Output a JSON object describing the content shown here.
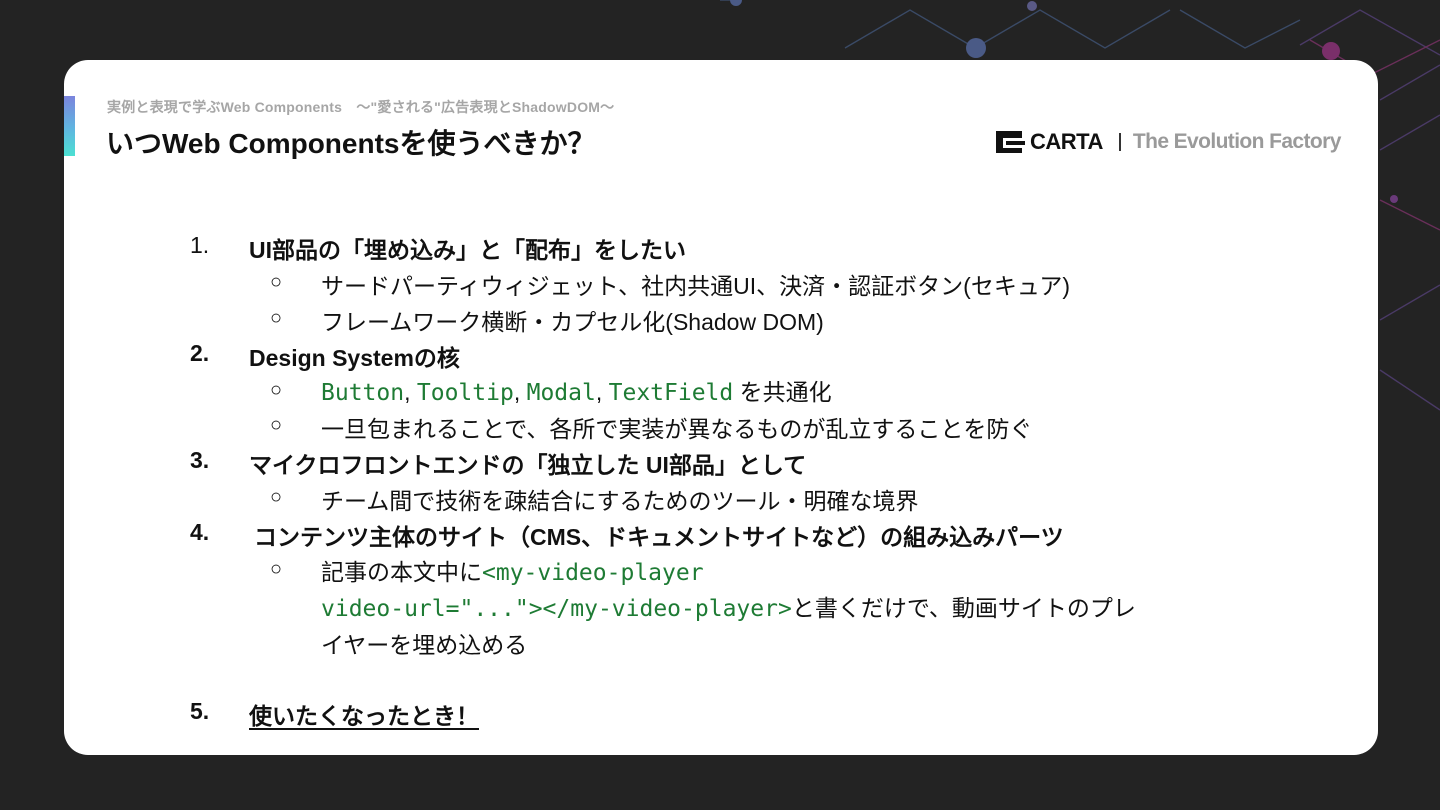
{
  "header": {
    "subtitle": "実例と表現で学ぶWeb Components　～\"愛される\"広告表現とShadowDOM～",
    "title": "いつWeb Componentsを使うべきか？"
  },
  "logo": {
    "brand": "CARTA",
    "tagline": "The Evolution Factory"
  },
  "items": [
    {
      "number": "1.",
      "heading": "UI部品の「埋め込み」と「配布」をしたい",
      "bullets": [
        "サードパーティウィジェット、社内共通UI、決済・認証ボタン(セキュア)",
        "フレームワーク横断・カプセル化(Shadow DOM)"
      ]
    },
    {
      "number": "2.",
      "heading": "Design Systemの核",
      "bullets": [
        {
          "code1": "Button",
          "sep1": ", ",
          "code2": "Tooltip",
          "sep2": ", ",
          "code3": "Modal",
          "sep3": ", ",
          "code4": "TextField",
          "text": " を共通化"
        },
        "一旦包まれることで、各所で実装が異なるものが乱立することを防ぐ"
      ]
    },
    {
      "number": "3.",
      "heading": "マイクロフロントエンドの「独立した UI部品」として",
      "bullets": [
        "チーム間で技術を疎結合にするためのツール・明確な境界"
      ]
    },
    {
      "number": "4.",
      "heading": "コンテンツ主体のサイト（CMS、ドキュメントサイトなど）の組み込みパーツ",
      "bullets": [
        {
          "text_before": "記事の本文中に",
          "code_line1": "<my-video-player",
          "code_line2": "video-url=\"...\"></my-video-player>",
          "text_after_1": "と書くだけで、動画サイトのプレ",
          "text_after_2": "イヤーを埋め込める"
        }
      ]
    },
    {
      "number": "5.",
      "heading": "使いたくなったとき！"
    }
  ],
  "bullet_glyph": "○",
  "colors": {
    "code": "#1e7b34",
    "background": "#232323",
    "card": "#ffffff",
    "accent_start": "#7b84dd",
    "accent_end": "#4ce0d2"
  }
}
